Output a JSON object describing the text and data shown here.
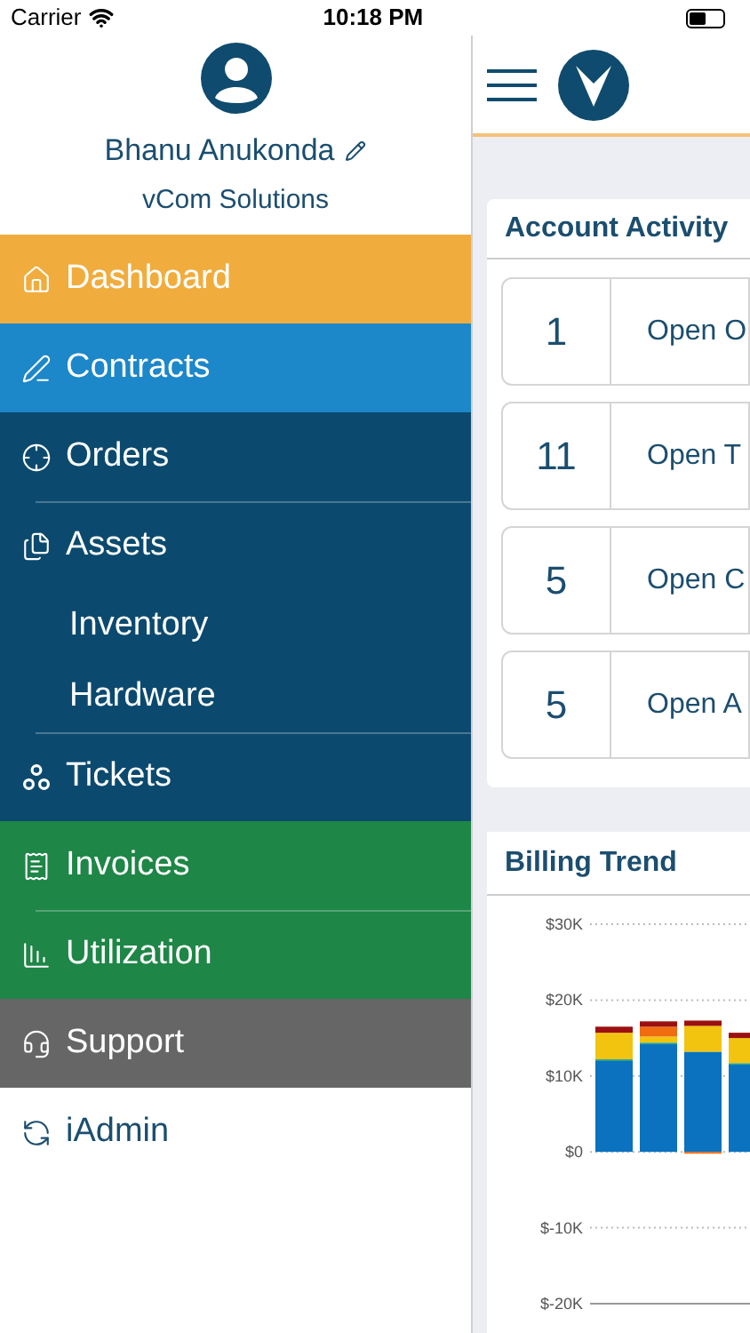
{
  "status_bar": {
    "carrier": "Carrier",
    "time": "10:18 PM"
  },
  "profile": {
    "name": "Bhanu Anukonda",
    "company": "vCom Solutions"
  },
  "menu": [
    {
      "label": "Dashboard",
      "color": "#f0ad3e"
    },
    {
      "label": "Contracts",
      "color": "#1c87c9"
    },
    {
      "label": "Orders",
      "color": "#0b4a6e"
    },
    {
      "label": "Assets",
      "color": "#0b4a6e",
      "children": [
        {
          "label": "Inventory"
        },
        {
          "label": "Hardware"
        }
      ]
    },
    {
      "label": "Tickets",
      "color": "#0b4a6e"
    },
    {
      "label": "Invoices",
      "color": "#1e8646"
    },
    {
      "label": "Utilization",
      "color": "#1e8646"
    },
    {
      "label": "Support",
      "color": "#666666"
    },
    {
      "label": "iAdmin",
      "color": "#ffffff"
    }
  ],
  "account_activity": {
    "title": "Account Activity",
    "rows": [
      {
        "count": "1",
        "label": "Open O"
      },
      {
        "count": "11",
        "label": "Open T"
      },
      {
        "count": "5",
        "label": "Open C"
      },
      {
        "count": "5",
        "label": "Open A"
      }
    ]
  },
  "billing_trend": {
    "title": "Billing Trend",
    "chart_data": {
      "type": "bar",
      "stacked": true,
      "grid": true,
      "ylim": [
        -20000,
        30000
      ],
      "yticks": [
        {
          "value": 30000,
          "label": "$30K"
        },
        {
          "value": 20000,
          "label": "$20K"
        },
        {
          "value": 10000,
          "label": "$10K"
        },
        {
          "value": 0,
          "label": "$0"
        },
        {
          "value": -10000,
          "label": "$-10K"
        },
        {
          "value": -20000,
          "label": "$-20K"
        }
      ],
      "series": [
        {
          "color": "#0a72bf",
          "values": [
            12000,
            14200,
            13200,
            11500
          ]
        },
        {
          "color": "#2aa39a",
          "values": [
            200,
            200,
            0,
            200
          ]
        },
        {
          "color": "#f2c40f",
          "values": [
            3500,
            800,
            3400,
            3300
          ]
        },
        {
          "color": "#ef6c10",
          "values": [
            0,
            1300,
            -200,
            0
          ]
        },
        {
          "color": "#9b1010",
          "values": [
            800,
            700,
            700,
            700
          ]
        }
      ]
    }
  }
}
